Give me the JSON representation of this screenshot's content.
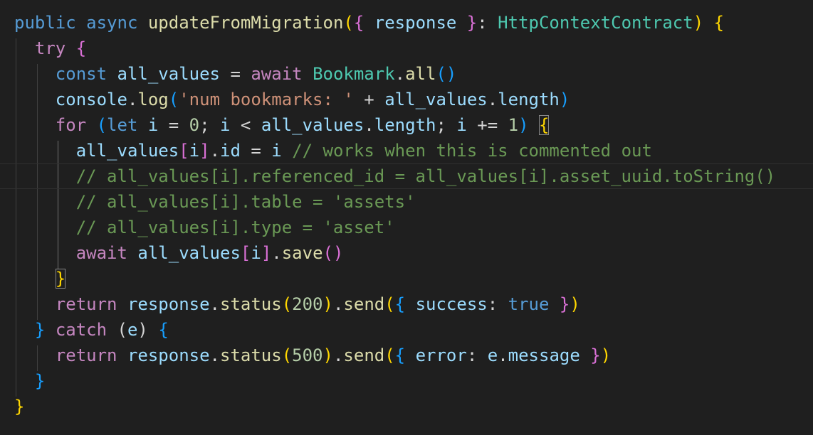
{
  "editor": {
    "lines": [
      [
        {
          "t": "public ",
          "c": "kw-blue"
        },
        {
          "t": "async ",
          "c": "kw-blue"
        },
        {
          "t": "updateFromMigration",
          "c": "fn"
        },
        {
          "t": "(",
          "c": "b1"
        },
        {
          "t": "{ ",
          "c": "b2"
        },
        {
          "t": "response",
          "c": "var"
        },
        {
          "t": " }",
          "c": "b2"
        },
        {
          "t": ": ",
          "c": "punc"
        },
        {
          "t": "HttpContextContract",
          "c": "type"
        },
        {
          "t": ")",
          "c": "b1"
        },
        {
          "t": " ",
          "c": "punc"
        },
        {
          "t": "{",
          "c": "b1"
        }
      ],
      [
        {
          "t": "  ",
          "c": "punc"
        },
        {
          "t": "try ",
          "c": "kw-purple"
        },
        {
          "t": "{",
          "c": "b2"
        }
      ],
      [
        {
          "t": "    ",
          "c": "punc"
        },
        {
          "t": "const ",
          "c": "kw-blue"
        },
        {
          "t": "all_values",
          "c": "var"
        },
        {
          "t": " = ",
          "c": "punc"
        },
        {
          "t": "await ",
          "c": "kw-purple"
        },
        {
          "t": "Bookmark",
          "c": "type"
        },
        {
          "t": ".",
          "c": "punc"
        },
        {
          "t": "all",
          "c": "fn"
        },
        {
          "t": "()",
          "c": "b3"
        }
      ],
      [
        {
          "t": "    ",
          "c": "punc"
        },
        {
          "t": "console",
          "c": "var"
        },
        {
          "t": ".",
          "c": "punc"
        },
        {
          "t": "log",
          "c": "fn"
        },
        {
          "t": "(",
          "c": "b3"
        },
        {
          "t": "'num bookmarks: '",
          "c": "str"
        },
        {
          "t": " + ",
          "c": "punc"
        },
        {
          "t": "all_values",
          "c": "var"
        },
        {
          "t": ".",
          "c": "punc"
        },
        {
          "t": "length",
          "c": "var"
        },
        {
          "t": ")",
          "c": "b3"
        }
      ],
      [
        {
          "t": "    ",
          "c": "punc"
        },
        {
          "t": "for ",
          "c": "kw-purple"
        },
        {
          "t": "(",
          "c": "b3"
        },
        {
          "t": "let ",
          "c": "kw-blue"
        },
        {
          "t": "i",
          "c": "var"
        },
        {
          "t": " = ",
          "c": "punc"
        },
        {
          "t": "0",
          "c": "num"
        },
        {
          "t": "; ",
          "c": "punc"
        },
        {
          "t": "i",
          "c": "var"
        },
        {
          "t": " < ",
          "c": "punc"
        },
        {
          "t": "all_values",
          "c": "var"
        },
        {
          "t": ".",
          "c": "punc"
        },
        {
          "t": "length",
          "c": "var"
        },
        {
          "t": "; ",
          "c": "punc"
        },
        {
          "t": "i",
          "c": "var"
        },
        {
          "t": " += ",
          "c": "punc"
        },
        {
          "t": "1",
          "c": "num"
        },
        {
          "t": ")",
          "c": "b3"
        },
        {
          "t": " ",
          "c": "punc"
        },
        {
          "t": "{",
          "c": "b1",
          "m": true
        }
      ],
      [
        {
          "t": "      ",
          "c": "punc"
        },
        {
          "t": "all_values",
          "c": "var"
        },
        {
          "t": "[",
          "c": "b2"
        },
        {
          "t": "i",
          "c": "var"
        },
        {
          "t": "]",
          "c": "b2"
        },
        {
          "t": ".",
          "c": "punc"
        },
        {
          "t": "id",
          "c": "var"
        },
        {
          "t": " = ",
          "c": "punc"
        },
        {
          "t": "i",
          "c": "var"
        },
        {
          "t": " ",
          "c": "punc"
        },
        {
          "t": "// works when this is commented out",
          "c": "cmt"
        }
      ],
      [
        {
          "t": "      ",
          "c": "punc"
        },
        {
          "t": "// all_values[i].referenced_id = all_values[i].asset_uuid.toString()",
          "c": "cmt"
        }
      ],
      [
        {
          "t": "      ",
          "c": "punc"
        },
        {
          "t": "// all_values[i].table = 'assets'",
          "c": "cmt"
        }
      ],
      [
        {
          "t": "      ",
          "c": "punc"
        },
        {
          "t": "// all_values[i].type = 'asset'",
          "c": "cmt"
        }
      ],
      [
        {
          "t": "      ",
          "c": "punc"
        },
        {
          "t": "await ",
          "c": "kw-purple"
        },
        {
          "t": "all_values",
          "c": "var"
        },
        {
          "t": "[",
          "c": "b2"
        },
        {
          "t": "i",
          "c": "var"
        },
        {
          "t": "]",
          "c": "b2"
        },
        {
          "t": ".",
          "c": "punc"
        },
        {
          "t": "save",
          "c": "fn"
        },
        {
          "t": "()",
          "c": "b2"
        }
      ],
      [
        {
          "t": "    ",
          "c": "punc"
        },
        {
          "t": "}",
          "c": "b1",
          "m": true
        }
      ],
      [
        {
          "t": "    ",
          "c": "punc"
        },
        {
          "t": "return ",
          "c": "kw-purple"
        },
        {
          "t": "response",
          "c": "var"
        },
        {
          "t": ".",
          "c": "punc"
        },
        {
          "t": "status",
          "c": "fn"
        },
        {
          "t": "(",
          "c": "b1"
        },
        {
          "t": "200",
          "c": "num"
        },
        {
          "t": ")",
          "c": "b1"
        },
        {
          "t": ".",
          "c": "punc"
        },
        {
          "t": "send",
          "c": "fn"
        },
        {
          "t": "(",
          "c": "b1"
        },
        {
          "t": "{ ",
          "c": "b3"
        },
        {
          "t": "success",
          "c": "var"
        },
        {
          "t": ": ",
          "c": "punc"
        },
        {
          "t": "true",
          "c": "kw-blue"
        },
        {
          "t": " }",
          "c": "b2"
        },
        {
          "t": ")",
          "c": "b1"
        }
      ],
      [
        {
          "t": "  ",
          "c": "punc"
        },
        {
          "t": "} ",
          "c": "b3"
        },
        {
          "t": "catch ",
          "c": "kw-purple"
        },
        {
          "t": "(",
          "c": "punc"
        },
        {
          "t": "e",
          "c": "var"
        },
        {
          "t": ")",
          "c": "punc"
        },
        {
          "t": " ",
          "c": "punc"
        },
        {
          "t": "{",
          "c": "b3"
        }
      ],
      [
        {
          "t": "    ",
          "c": "punc"
        },
        {
          "t": "return ",
          "c": "kw-purple"
        },
        {
          "t": "response",
          "c": "var"
        },
        {
          "t": ".",
          "c": "punc"
        },
        {
          "t": "status",
          "c": "fn"
        },
        {
          "t": "(",
          "c": "b1"
        },
        {
          "t": "500",
          "c": "num"
        },
        {
          "t": ")",
          "c": "b1"
        },
        {
          "t": ".",
          "c": "punc"
        },
        {
          "t": "send",
          "c": "fn"
        },
        {
          "t": "(",
          "c": "b1"
        },
        {
          "t": "{ ",
          "c": "b3"
        },
        {
          "t": "error",
          "c": "var"
        },
        {
          "t": ": ",
          "c": "punc"
        },
        {
          "t": "e",
          "c": "var"
        },
        {
          "t": ".",
          "c": "punc"
        },
        {
          "t": "message",
          "c": "var"
        },
        {
          "t": " }",
          "c": "b2"
        },
        {
          "t": ")",
          "c": "b1"
        }
      ],
      [
        {
          "t": "  ",
          "c": "punc"
        },
        {
          "t": "}",
          "c": "b3"
        }
      ],
      [
        {
          "t": "}",
          "c": "b1"
        }
      ]
    ],
    "current_line": 6
  }
}
